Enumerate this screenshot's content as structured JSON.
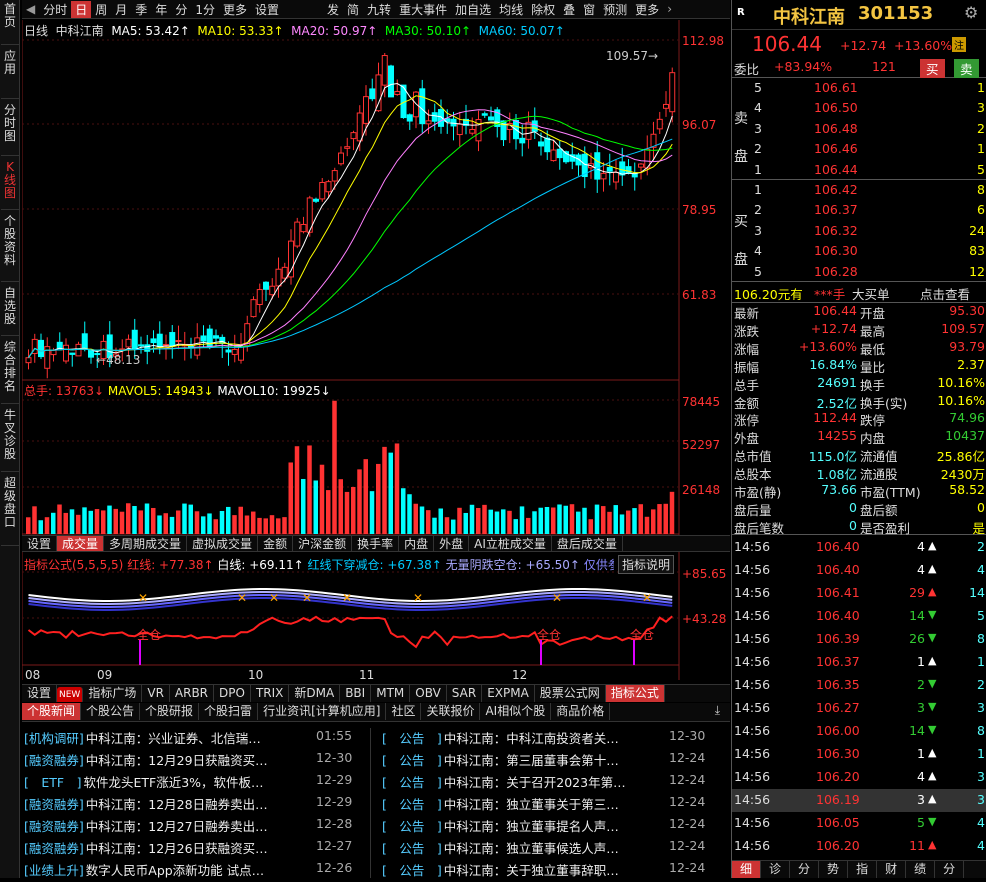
{
  "left_tabs": [
    "首页",
    "应用",
    "分时图",
    "K线图",
    "个股资料",
    "自选股",
    "综合排名",
    "牛叉诊股",
    "超级盘口"
  ],
  "toolbar": [
    "分时",
    "日",
    "周",
    "月",
    "季",
    "年",
    "分",
    "1分",
    "更多",
    "设置",
    "发",
    "简",
    "九转",
    "重大事件",
    "加自选",
    "均线",
    "除权",
    "叠",
    "窗",
    "预测",
    "更多"
  ],
  "ma_line": {
    "period": "日线",
    "name": "中科江南",
    "ma5": "MA5: 53.42↑",
    "ma10": "MA10: 53.33↑",
    "ma20": "MA20: 50.97↑",
    "ma30": "MA30: 50.10↑",
    "ma60": "MA60: 50.07↑"
  },
  "price_axis": [
    "112.98",
    "96.07",
    "78.95",
    "61.83"
  ],
  "price_marks": {
    "high": "109.57",
    "low": "48.13"
  },
  "vol_line": {
    "total": "总手: 13763↓",
    "mavol5": "MAVOL5: 14943↓",
    "mavol10": "MAVOL10: 19925↓"
  },
  "vol_axis": [
    "78445",
    "52297",
    "26148"
  ],
  "vol_tabs": [
    "设置",
    "成交量",
    "多周期成交量",
    "虚拟成交量",
    "金额",
    "沪深金额",
    "换手率",
    "内盘",
    "外盘",
    "AI立桩成交量",
    "盘后成交量"
  ],
  "ind_line": {
    "a": "指标公式(5,5,5,5)",
    "b": "红线: +77.38↑",
    "c": "白线: +69.11↑",
    "d": "红线下穿减仓: +67.38↑",
    "e": "无量阴跌空仓: +65.50↑",
    "f": "仅供参考: +63.4",
    "btn": "指标说明"
  },
  "ind_axis": [
    "+85.65",
    "+43.28"
  ],
  "ind_labels": [
    "全仓",
    "全仓",
    "全仓"
  ],
  "months": [
    "08",
    "09",
    "10",
    "11",
    "12"
  ],
  "ind_tabs": [
    "设置",
    "NEW",
    "指标广场",
    "VR",
    "ARBR",
    "DPO",
    "TRIX",
    "新DMA",
    "BBI",
    "MTM",
    "OBV",
    "SAR",
    "EXPMA",
    "股票公式网",
    "指标公式"
  ],
  "news_tabs": [
    "个股新闻",
    "个股公告",
    "个股研报",
    "个股扫雷",
    "行业资讯[计算机应用]",
    "社区",
    "关联报价",
    "AI相似个股",
    "商品价格"
  ],
  "news_left": [
    {
      "tag": "[机构调研]",
      "title": "中科江南：兴业证券、北信瑞…",
      "date": "01:55"
    },
    {
      "tag": "[融资融券]",
      "title": "中科江南：12月29日获融资买…",
      "date": "12-30"
    },
    {
      "tag": "[　ETF　]",
      "title": "软件龙头ETF涨近3%，软件板…",
      "date": "12-29"
    },
    {
      "tag": "[融资融券]",
      "title": "中科江南：12月28日融券卖出…",
      "date": "12-29"
    },
    {
      "tag": "[融资融券]",
      "title": "中科江南：12月27日融券卖出…",
      "date": "12-28"
    },
    {
      "tag": "[融资融券]",
      "title": "中科江南：12月26日获融资买…",
      "date": "12-27"
    },
    {
      "tag": "[业绩上升]",
      "title": "数字人民币App添新功能 试点…",
      "date": "12-26"
    }
  ],
  "news_right": [
    {
      "tag": "[　公告　]",
      "title": "中科江南：中科江南投资者关…",
      "date": "12-30"
    },
    {
      "tag": "[　公告　]",
      "title": "中科江南：第三届董事会第十…",
      "date": "12-24"
    },
    {
      "tag": "[　公告　]",
      "title": "中科江南：关于召开2023年第…",
      "date": "12-24"
    },
    {
      "tag": "[　公告　]",
      "title": "中科江南：独立董事关于第三…",
      "date": "12-24"
    },
    {
      "tag": "[　公告　]",
      "title": "中科江南：独立董事提名人声…",
      "date": "12-24"
    },
    {
      "tag": "[　公告　]",
      "title": "中科江南：独立董事候选人声…",
      "date": "12-24"
    },
    {
      "tag": "[　公告　]",
      "title": "中科江南：关于独立董事辞职…",
      "date": "12-24"
    }
  ],
  "quote": {
    "r": "R",
    "name": "中科江南",
    "code": "301153",
    "price": "106.44",
    "change": "+12.74",
    "pct": "+13.60%",
    "badge": "注",
    "weibi_l": "委比",
    "weibi": "+83.94%",
    "weicha": "121",
    "buy": "买",
    "sell": "卖"
  },
  "sell_side": "卖盘",
  "buy_side": "买盘",
  "asks": [
    [
      "5",
      "106.61",
      "1"
    ],
    [
      "4",
      "106.50",
      "3"
    ],
    [
      "3",
      "106.48",
      "2"
    ],
    [
      "2",
      "106.46",
      "1"
    ],
    [
      "1",
      "106.44",
      "5"
    ]
  ],
  "bids": [
    [
      "1",
      "106.42",
      "8"
    ],
    [
      "2",
      "106.37",
      "6"
    ],
    [
      "3",
      "106.32",
      "24"
    ],
    [
      "4",
      "106.30",
      "83"
    ],
    [
      "5",
      "106.28",
      "12"
    ]
  ],
  "bigbuy": {
    "price": "106.20元有",
    "hands": "***手",
    "label": "大买单",
    "link": "点击查看"
  },
  "stats": [
    [
      "最新",
      "106.44",
      "开盘",
      "95.30"
    ],
    [
      "涨跌",
      "+12.74",
      "最高",
      "109.57"
    ],
    [
      "涨幅",
      "+13.60%",
      "最低",
      "93.79"
    ],
    [
      "振幅",
      "16.84%",
      "量比",
      "2.37"
    ],
    [
      "总手",
      "24691",
      "换手",
      "10.16%"
    ],
    [
      "金额",
      "2.52亿",
      "换手(实)",
      "10.16%"
    ],
    [
      "涨停",
      "112.44",
      "跌停",
      "74.96"
    ],
    [
      "外盘",
      "14255",
      "内盘",
      "10437"
    ],
    [
      "总市值",
      "115.0亿",
      "流通值",
      "25.86亿"
    ],
    [
      "总股本",
      "1.08亿",
      "流通股",
      "2430万"
    ],
    [
      "市盈(静)",
      "73.66",
      "市盈(TTM)",
      "58.52"
    ],
    [
      "盘后量",
      "0",
      "盘后额",
      "0"
    ],
    [
      "盘后笔数",
      "0",
      "是否盈利",
      "是"
    ]
  ],
  "ticks": [
    [
      "14:56",
      "106.40",
      "4",
      "up",
      "2"
    ],
    [
      "14:56",
      "106.40",
      "4",
      "up",
      "4"
    ],
    [
      "14:56",
      "106.41",
      "29",
      "up",
      "14"
    ],
    [
      "14:56",
      "106.40",
      "14",
      "down",
      "5"
    ],
    [
      "14:56",
      "106.39",
      "26",
      "down",
      "8"
    ],
    [
      "14:56",
      "106.37",
      "1",
      "up",
      "1"
    ],
    [
      "14:56",
      "106.35",
      "2",
      "down",
      "2"
    ],
    [
      "14:56",
      "106.27",
      "3",
      "down",
      "3"
    ],
    [
      "14:56",
      "106.00",
      "14",
      "down",
      "8"
    ],
    [
      "14:56",
      "106.30",
      "1",
      "up",
      "1"
    ],
    [
      "14:56",
      "106.20",
      "4",
      "up",
      "3"
    ],
    [
      "14:56",
      "106.19",
      "3",
      "up",
      "3"
    ],
    [
      "14:56",
      "106.05",
      "5",
      "down",
      "4"
    ],
    [
      "14:56",
      "106.20",
      "11",
      "up",
      "4"
    ]
  ],
  "detail_tabs": [
    "细",
    "诊",
    "分",
    "势",
    "指",
    "财",
    "绩",
    "分"
  ],
  "colors": {
    "up": "#ff3232",
    "down": "#00ffff",
    "ma5": "#ffffff",
    "ma10": "#ffff00",
    "ma20": "#ff80ff",
    "ma30": "#00ff00",
    "ma60": "#00c8ff"
  }
}
